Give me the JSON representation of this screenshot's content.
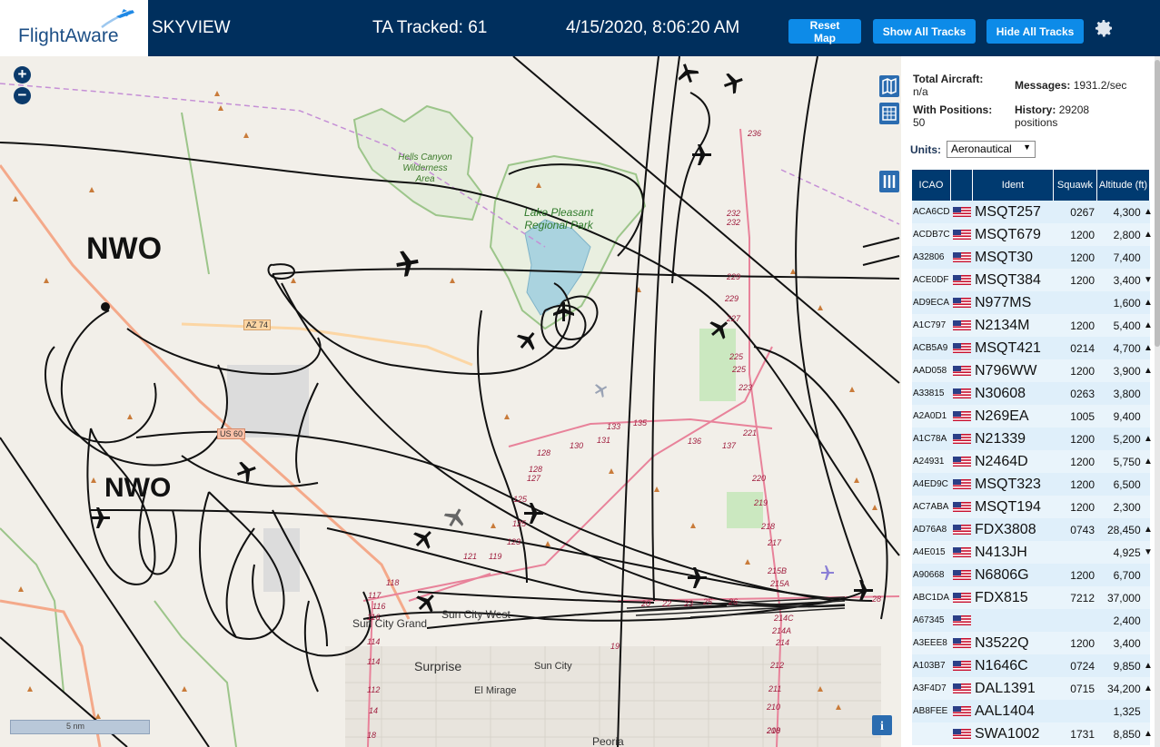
{
  "header": {
    "logo": "FlightAware",
    "app_name": "SKYVIEW",
    "tracked": "TA Tracked: 61",
    "datetime": "4/15/2020, 8:06:20 AM",
    "reset_label": "Reset Map",
    "show_label": "Show All Tracks",
    "hide_label": "Hide All Tracks"
  },
  "stats": {
    "total_label": "Total Aircraft:",
    "total_value": "n/a",
    "positions_label": "With Positions:",
    "positions_value": "50",
    "messages_label": "Messages:",
    "messages_value": "1931.2/sec",
    "history_label": "History:",
    "history_value": "29208 positions"
  },
  "units": {
    "label": "Units:",
    "selected": "Aeronautical"
  },
  "table": {
    "columns": [
      "ICAO",
      "",
      "Ident",
      "Squawk",
      "Altitude (ft)"
    ],
    "rows": [
      {
        "icao": "ACA6CD",
        "ident": "MSQT257",
        "squawk": "0267",
        "alt": "4,300",
        "trend": "▲"
      },
      {
        "icao": "ACDB7C",
        "ident": "MSQT679",
        "squawk": "1200",
        "alt": "2,800",
        "trend": "▲"
      },
      {
        "icao": "A32806",
        "ident": "MSQT30",
        "squawk": "1200",
        "alt": "7,400",
        "trend": ""
      },
      {
        "icao": "ACE0DF",
        "ident": "MSQT384",
        "squawk": "1200",
        "alt": "3,400",
        "trend": "▼"
      },
      {
        "icao": "AD9ECA",
        "ident": "N977MS",
        "squawk": "",
        "alt": "1,600",
        "trend": "▲"
      },
      {
        "icao": "A1C797",
        "ident": "N2134M",
        "squawk": "1200",
        "alt": "5,400",
        "trend": "▲"
      },
      {
        "icao": "ACB5A9",
        "ident": "MSQT421",
        "squawk": "0214",
        "alt": "4,700",
        "trend": "▲"
      },
      {
        "icao": "AAD058",
        "ident": "N796WW",
        "squawk": "1200",
        "alt": "3,900",
        "trend": "▲"
      },
      {
        "icao": "A33815",
        "ident": "N30608",
        "squawk": "0263",
        "alt": "3,800",
        "trend": ""
      },
      {
        "icao": "A2A0D1",
        "ident": "N269EA",
        "squawk": "1005",
        "alt": "9,400",
        "trend": ""
      },
      {
        "icao": "A1C78A",
        "ident": "N21339",
        "squawk": "1200",
        "alt": "5,200",
        "trend": "▲"
      },
      {
        "icao": "A24931",
        "ident": "N2464D",
        "squawk": "1200",
        "alt": "5,750",
        "trend": "▲"
      },
      {
        "icao": "A4ED9C",
        "ident": "MSQT323",
        "squawk": "1200",
        "alt": "6,500",
        "trend": ""
      },
      {
        "icao": "AC7ABA",
        "ident": "MSQT194",
        "squawk": "1200",
        "alt": "2,300",
        "trend": ""
      },
      {
        "icao": "AD76A8",
        "ident": "FDX3808",
        "squawk": "0743",
        "alt": "28,450",
        "trend": "▲"
      },
      {
        "icao": "A4E015",
        "ident": "N413JH",
        "squawk": "",
        "alt": "4,925",
        "trend": "▼"
      },
      {
        "icao": "A90668",
        "ident": "N6806G",
        "squawk": "1200",
        "alt": "6,700",
        "trend": ""
      },
      {
        "icao": "ABC1DA",
        "ident": "FDX815",
        "squawk": "7212",
        "alt": "37,000",
        "trend": ""
      },
      {
        "icao": "A67345",
        "ident": "",
        "squawk": "",
        "alt": "2,400",
        "trend": ""
      },
      {
        "icao": "A3EEE8",
        "ident": "N3522Q",
        "squawk": "1200",
        "alt": "3,400",
        "trend": ""
      },
      {
        "icao": "A103B7",
        "ident": "N1646C",
        "squawk": "0724",
        "alt": "9,850",
        "trend": "▲"
      },
      {
        "icao": "A3F4D7",
        "ident": "DAL1391",
        "squawk": "0715",
        "alt": "34,200",
        "trend": "▲"
      },
      {
        "icao": "AB8FEE",
        "ident": "AAL1404",
        "squawk": "",
        "alt": "1,325",
        "trend": ""
      },
      {
        "icao": "",
        "ident": "SWA1002",
        "squawk": "1731",
        "alt": "8,850",
        "trend": "▲"
      }
    ]
  },
  "map": {
    "annotation": "NWO",
    "annotation2": "NWO",
    "scale": "5 nm",
    "places": {
      "hells_canyon": "Hells Canyon Wilderness Area",
      "lake_pleasant": "Lake Pleasant Regional Park",
      "sun_city_grand": "Sun City Grand",
      "sun_city_west": "Sun City West",
      "surprise": "Surprise",
      "sun_city": "Sun City",
      "el_mirage": "El Mirage",
      "peoria": "Peoria"
    },
    "shields": {
      "az74": "AZ 74",
      "us60": "US 60"
    },
    "mile_markers": [
      "236",
      "232",
      "232",
      "229",
      "229",
      "227",
      "225",
      "225",
      "223",
      "221",
      "220",
      "219",
      "218",
      "217",
      "215B",
      "215A",
      "214C",
      "214A",
      "214",
      "212",
      "211",
      "210",
      "210",
      "208",
      "133",
      "135",
      "136",
      "137",
      "131",
      "130",
      "128",
      "128",
      "127",
      "125",
      "125",
      "123",
      "121",
      "119",
      "118",
      "117",
      "116",
      "116",
      "114",
      "114",
      "112",
      "14",
      "18",
      "19",
      "20",
      "22",
      "23",
      "25",
      "26",
      "28"
    ]
  }
}
